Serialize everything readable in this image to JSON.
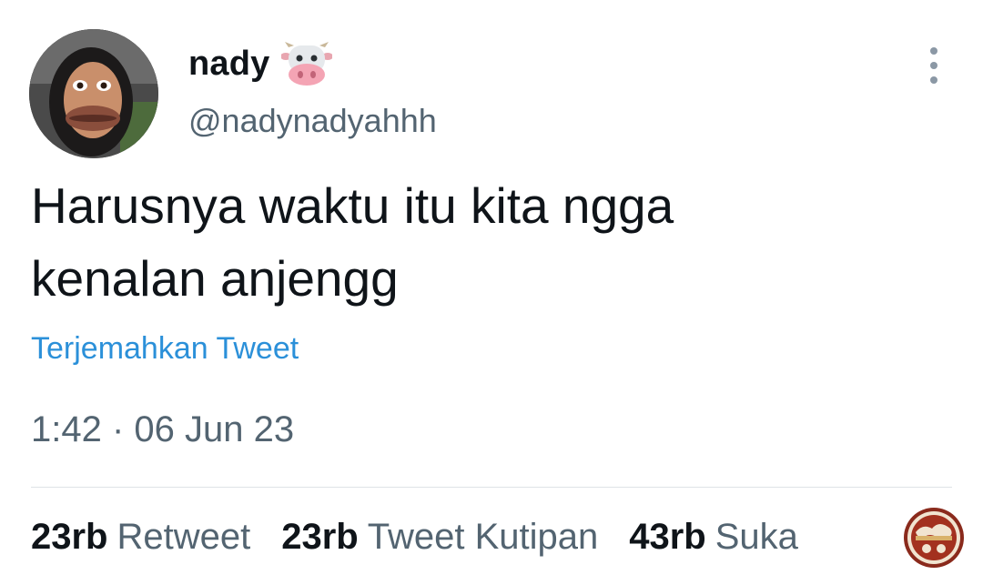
{
  "author": {
    "display_name": "nady",
    "name_emoji": "cow-face-icon",
    "handle": "@nadynadyahhh"
  },
  "tweet": {
    "text_line_1": "Harusnya waktu itu kita ngga",
    "text_line_2": "kenalan anjengg",
    "translate_label": "Terjemahkan Tweet",
    "timestamp": "1:42 · 06 Jun 23"
  },
  "stats": {
    "retweets": {
      "count": "23rb",
      "label": "Retweet"
    },
    "quotes": {
      "count": "23rb",
      "label": "Tweet Kutipan"
    },
    "likes": {
      "count": "43rb",
      "label": "Suka"
    }
  },
  "colors": {
    "text": "#0f1419",
    "secondary": "#536471",
    "link": "#2b90d9",
    "divider": "#dfe3e6"
  }
}
